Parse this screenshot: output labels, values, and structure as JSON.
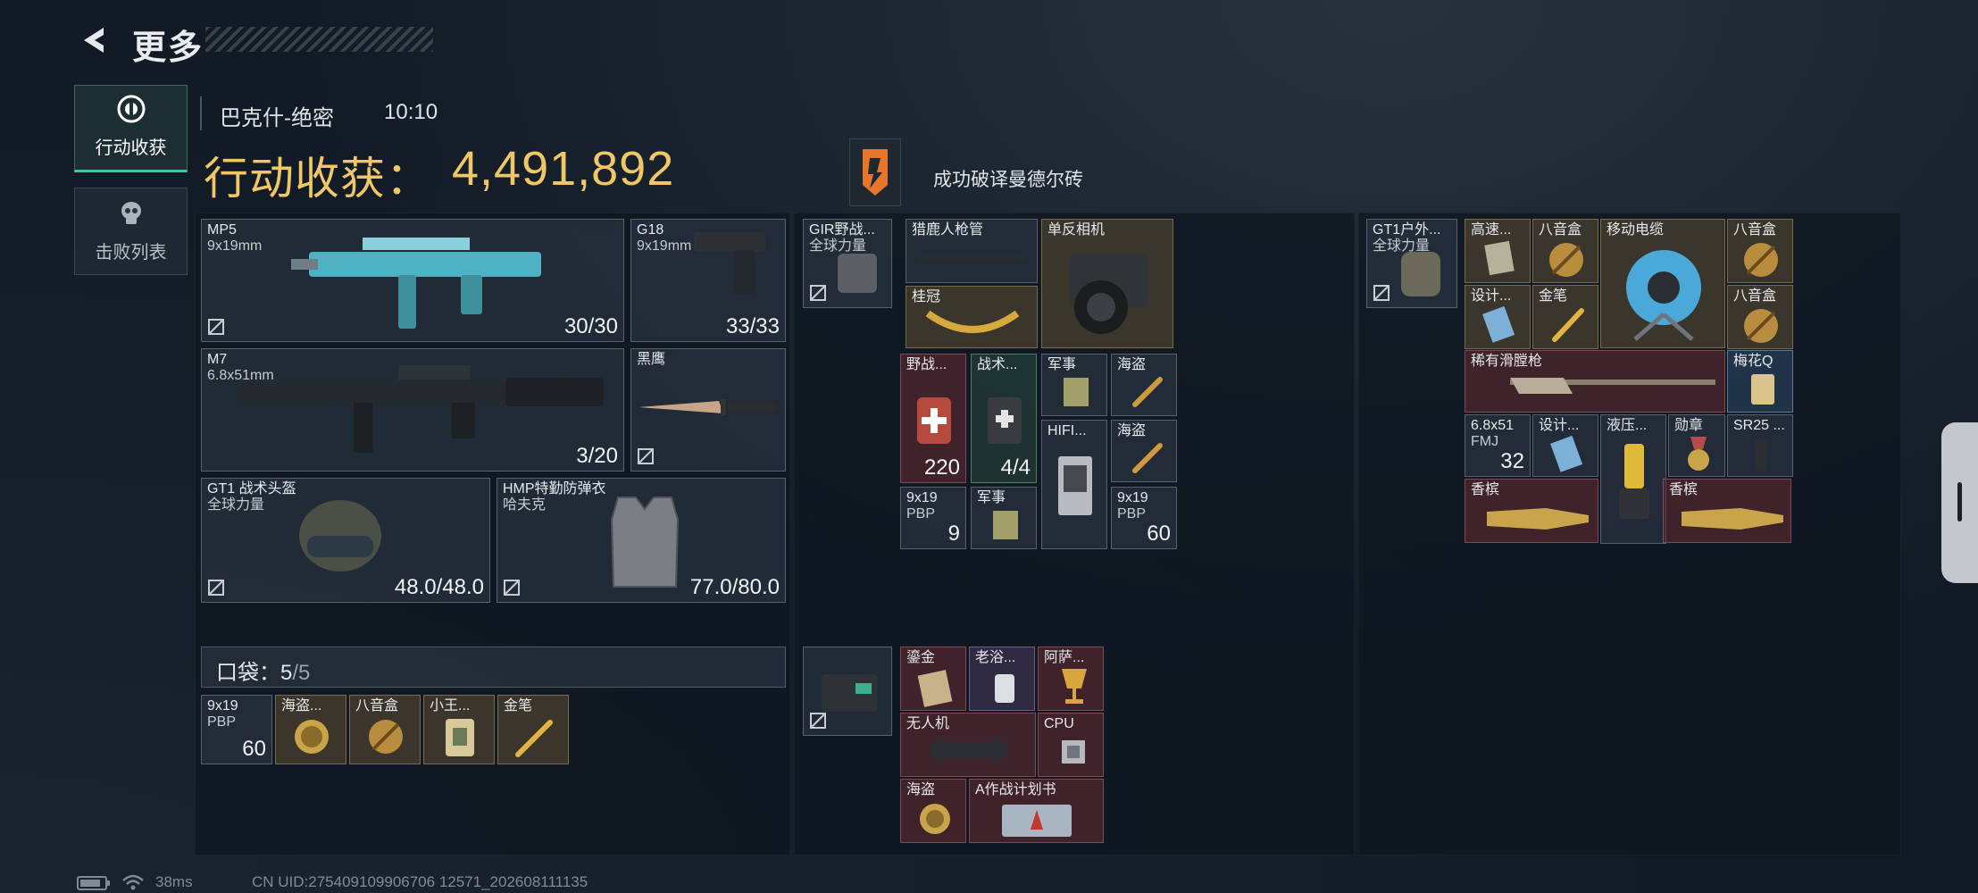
{
  "header": {
    "back_label": "更多",
    "nav_active": "行动收获",
    "nav_inactive": "击败列表",
    "map_name": "巴克什-绝密",
    "time": "10:10",
    "total_label": "行动收获：",
    "total_value": "4,491,892",
    "achievement": "成功破译曼德尔砖"
  },
  "gear": {
    "mp5": {
      "name": "MP5",
      "ammo": "9x19mm",
      "count": "30/30"
    },
    "g18": {
      "name": "G18",
      "ammo": "9x19mm",
      "count": "33/33"
    },
    "m7": {
      "name": "M7",
      "ammo": "6.8x51mm",
      "count": "3/20"
    },
    "knife": {
      "name": "黑鹰"
    },
    "helmet": {
      "name": "GT1 战术头盔",
      "sub": "全球力量",
      "count": "48.0/48.0"
    },
    "armor": {
      "name": "HMP特勤防弹衣",
      "sub": "哈夫克",
      "count": "77.0/80.0"
    }
  },
  "pocket": {
    "label": "口袋：",
    "count": "5",
    "max": "/5",
    "items": [
      {
        "name": "9x19",
        "sub": "PBP",
        "count": "60"
      },
      {
        "name": "海盗..."
      },
      {
        "name": "八音盒"
      },
      {
        "name": "小王..."
      },
      {
        "name": "金笔"
      }
    ]
  },
  "chest_rig": {
    "title": "GIR野战...",
    "sub": "全球力量",
    "items": [
      {
        "name": "猎鹿人枪管"
      },
      {
        "name": "单反相机"
      },
      {
        "name": "桂冠"
      },
      {
        "name": "野战..."
      },
      {
        "name": "战术..."
      },
      {
        "name": "军事"
      },
      {
        "name": "海盗"
      },
      {
        "name": "HIFI..."
      },
      {
        "name": "海盗"
      },
      {
        "name": "9x19",
        "sub": "PBP",
        "count": "9"
      },
      {
        "name": "军事"
      },
      {
        "name": "9x19",
        "sub": "PBP",
        "count": "60"
      }
    ],
    "counts": [
      "220",
      "4/4"
    ]
  },
  "secure_case": {
    "items": [
      {
        "name": "鎏金"
      },
      {
        "name": "老浴..."
      },
      {
        "name": "阿萨..."
      },
      {
        "name": "无人机"
      },
      {
        "name": "CPU"
      },
      {
        "name": "海盗"
      },
      {
        "name": "A作战计划书"
      }
    ]
  },
  "backpack": {
    "title": "GT1户外...",
    "sub": "全球力量",
    "items": [
      {
        "name": "高速..."
      },
      {
        "name": "八音盒"
      },
      {
        "name": "移动电缆"
      },
      {
        "name": "八音盒"
      },
      {
        "name": "设计..."
      },
      {
        "name": "金笔"
      },
      {
        "name": "八音盒"
      },
      {
        "name": "稀有滑膛枪"
      },
      {
        "name": "梅花Q"
      },
      {
        "name": "6.8x51",
        "sub": "FMJ",
        "count": "32"
      },
      {
        "name": "设计..."
      },
      {
        "name": "液压..."
      },
      {
        "name": "勋章"
      },
      {
        "name": "SR25 ..."
      },
      {
        "name": "香槟"
      },
      {
        "name": "香槟"
      }
    ]
  },
  "status_bar": {
    "ping": "38ms",
    "uid": "CN UID:275409109906706 12571_202608111135"
  },
  "colors": {
    "gold_text": "#f0c766",
    "accent_green": "#49c49a",
    "background": "#121b25"
  }
}
